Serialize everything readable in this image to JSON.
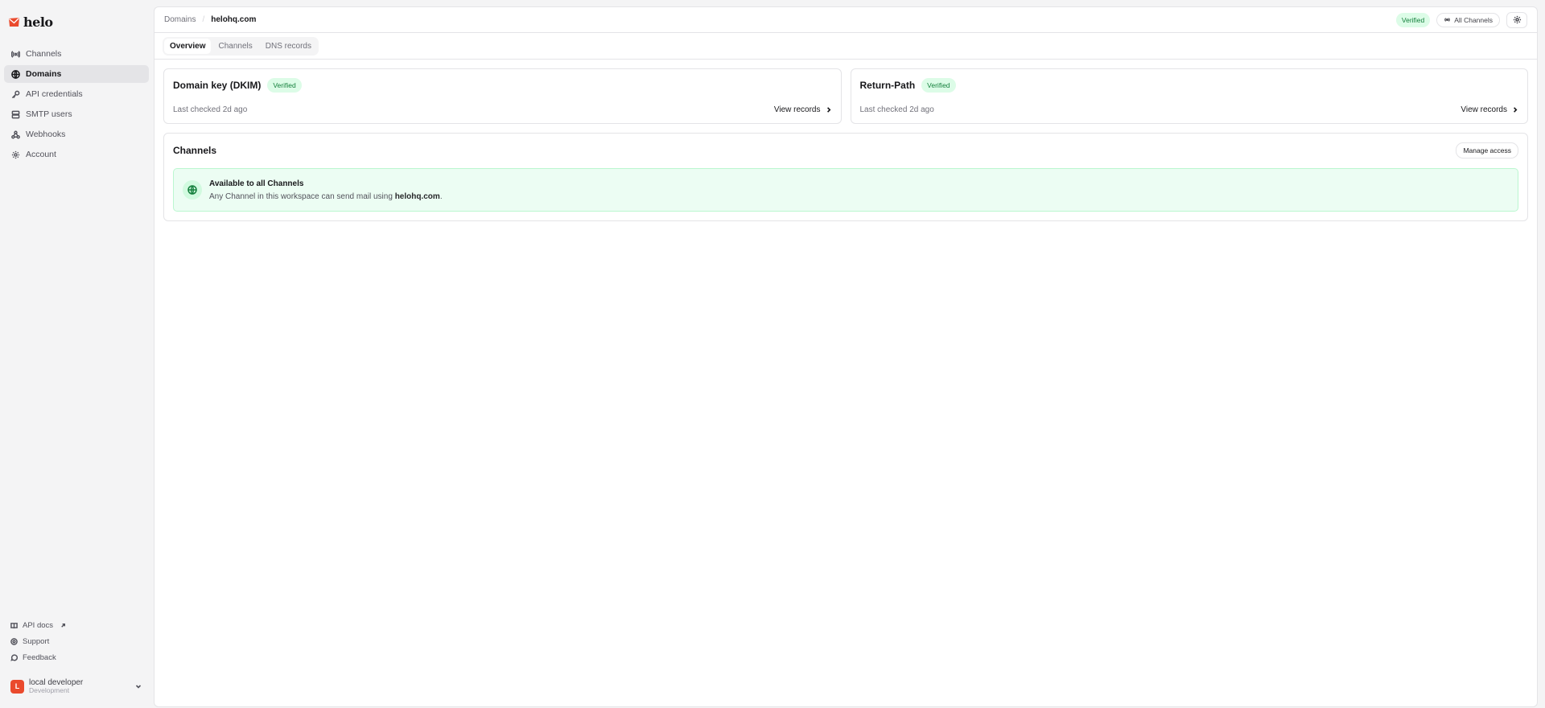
{
  "brand": {
    "name": "helo",
    "color": "#ea4a2d"
  },
  "sidebar": {
    "items": [
      {
        "label": "Channels",
        "icon": "broadcast-icon",
        "active": false
      },
      {
        "label": "Domains",
        "icon": "globe-icon",
        "active": true
      },
      {
        "label": "API credentials",
        "icon": "key-icon",
        "active": false
      },
      {
        "label": "SMTP users",
        "icon": "server-icon",
        "active": false
      },
      {
        "label": "Webhooks",
        "icon": "webhook-icon",
        "active": false
      },
      {
        "label": "Account",
        "icon": "gear-icon",
        "active": false
      }
    ],
    "footer": {
      "api_docs": "API docs",
      "support": "Support",
      "feedback": "Feedback"
    },
    "user": {
      "initial": "L",
      "name": "local developer",
      "env": "Development"
    }
  },
  "header": {
    "breadcrumb_root": "Domains",
    "breadcrumb_separator": "/",
    "breadcrumb_current": "helohq.com",
    "status_badge": "Verified",
    "channels_button": "All Channels"
  },
  "tabs": [
    {
      "label": "Overview",
      "active": true
    },
    {
      "label": "Channels",
      "active": false
    },
    {
      "label": "DNS records",
      "active": false
    }
  ],
  "cards": [
    {
      "title": "Domain key (DKIM)",
      "badge": "Verified",
      "sub": "Last checked 2d ago",
      "link": "View records"
    },
    {
      "title": "Return-Path",
      "badge": "Verified",
      "sub": "Last checked 2d ago",
      "link": "View records"
    }
  ],
  "channels_section": {
    "title": "Channels",
    "manage_button": "Manage access",
    "notice_title": "Available to all Channels",
    "notice_body_prefix": "Any Channel in this workspace can send mail using ",
    "notice_domain": "helohq.com",
    "notice_body_suffix": "."
  },
  "colors": {
    "verified_bg": "#dcfce7",
    "verified_text": "#15803d",
    "notice_bg": "#ecfdf3"
  }
}
